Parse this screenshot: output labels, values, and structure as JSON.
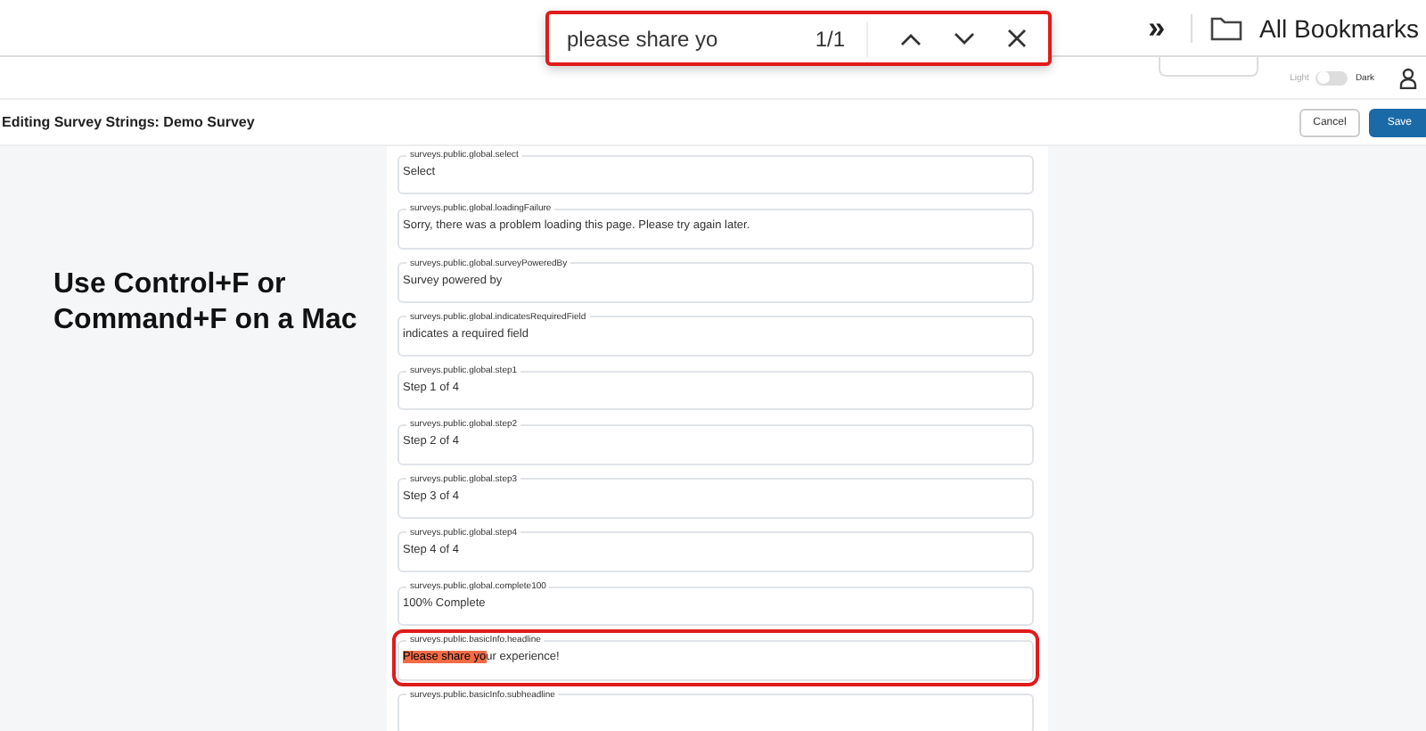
{
  "browser": {
    "overflow_button": "»",
    "bookmarks": "All Bookmarks"
  },
  "find_bar": {
    "query": "please share yo",
    "count": "1/1",
    "selected": true
  },
  "toolbar": {
    "theme_light": "Light",
    "theme_dark": "Dark",
    "dark_on": false
  },
  "header": {
    "title": "Editing Survey Strings: Demo Survey",
    "cancel": "Cancel",
    "save": "Save"
  },
  "hint": "Use Control+F or Command+F on a Mac",
  "fields": [
    {
      "label": "surveys.public.global.select",
      "value": "Select",
      "selected": false
    },
    {
      "label": "surveys.public.global.loadingFailure",
      "value": "Sorry, there was a problem loading this page. Please try again later.",
      "selected": false
    },
    {
      "label": "surveys.public.global.surveyPoweredBy",
      "value": "Survey powered by",
      "selected": false
    },
    {
      "label": "surveys.public.global.indicatesRequiredField",
      "value": "indicates a required field",
      "selected": false
    },
    {
      "label": "surveys.public.global.step1",
      "value": "Step 1 of 4",
      "selected": false
    },
    {
      "label": "surveys.public.global.step2",
      "value": "Step 2 of 4",
      "selected": false
    },
    {
      "label": "surveys.public.global.step3",
      "value": "Step 3 of 4",
      "selected": false
    },
    {
      "label": "surveys.public.global.step4",
      "value": "Step 4 of 4",
      "selected": false
    },
    {
      "label": "surveys.public.global.complete100",
      "value": "100% Complete",
      "selected": false
    },
    {
      "label": "surveys.public.basicInfo.headline",
      "highlight": "Please share yo",
      "value": "ur experience!",
      "selected": true
    },
    {
      "label": "surveys.public.basicInfo.subheadline",
      "selected": false
    }
  ]
}
